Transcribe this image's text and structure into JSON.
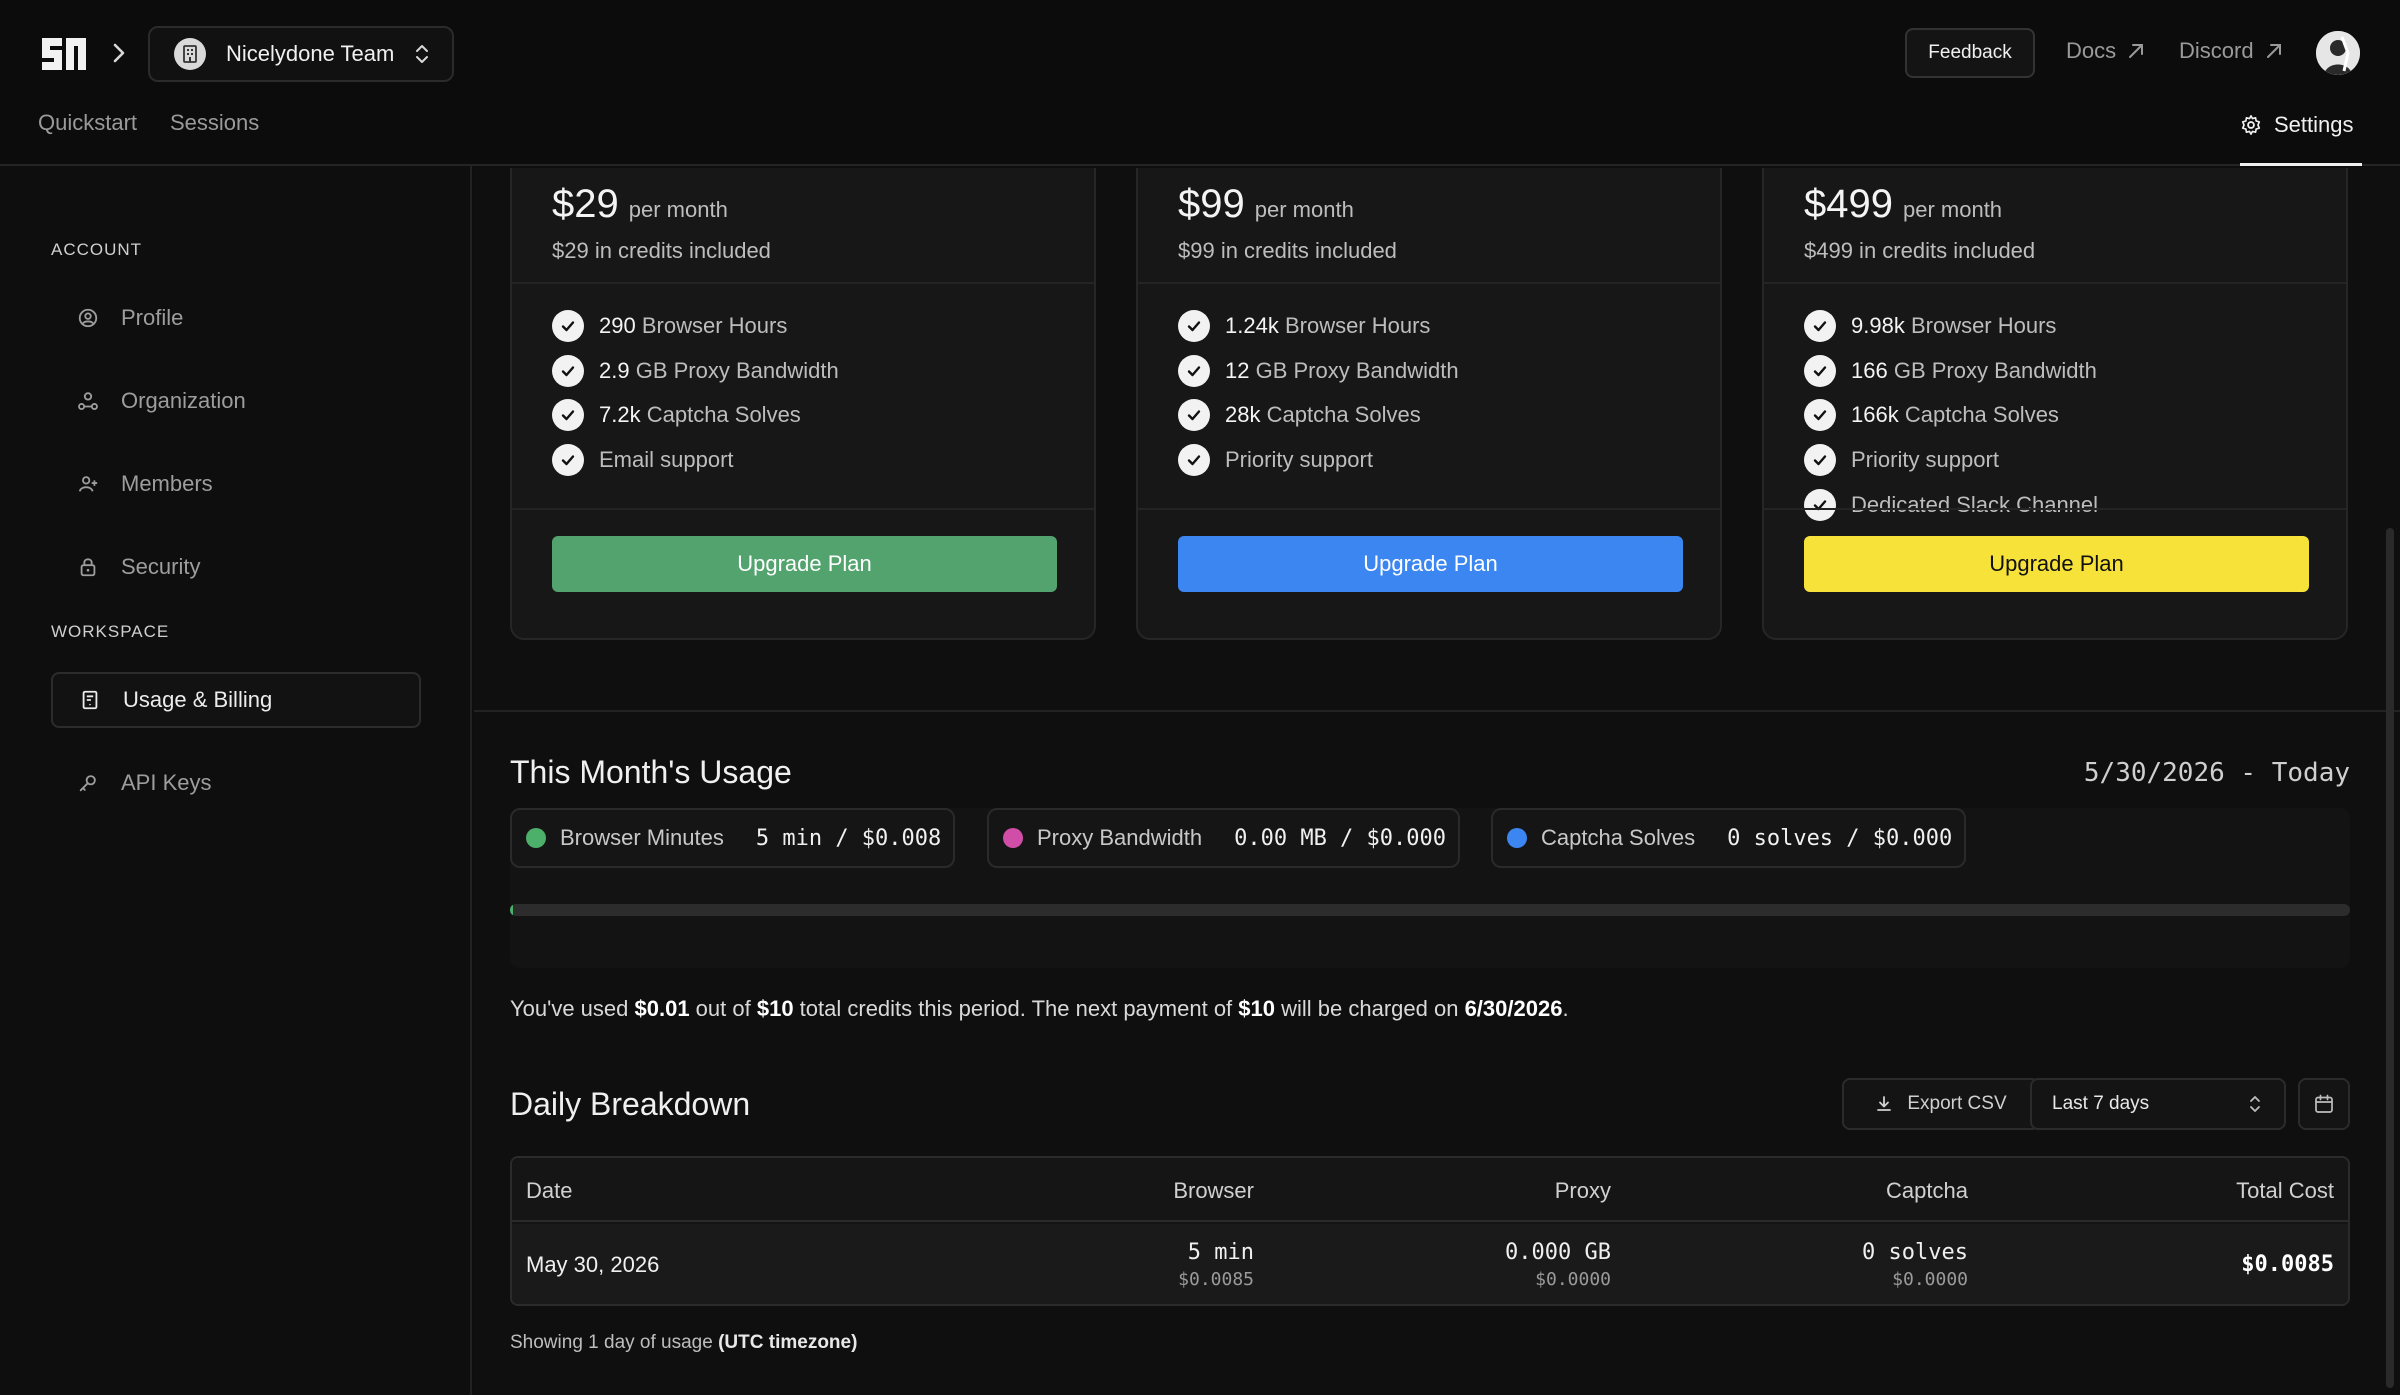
{
  "header": {
    "team_name": "Nicelydone Team",
    "feedback_label": "Feedback",
    "docs_label": "Docs",
    "discord_label": "Discord",
    "nav": [
      "Quickstart",
      "Sessions"
    ],
    "settings_label": "Settings"
  },
  "sidebar": {
    "account_label": "ACCOUNT",
    "workspace_label": "WORKSPACE",
    "items": [
      {
        "label": "Profile",
        "icon": "user-circle-icon"
      },
      {
        "label": "Organization",
        "icon": "organization-icon"
      },
      {
        "label": "Members",
        "icon": "add-user-icon"
      },
      {
        "label": "Security",
        "icon": "lock-icon"
      },
      {
        "label": "Usage & Billing",
        "icon": "receipt-icon",
        "active": true
      },
      {
        "label": "API Keys",
        "icon": "key-icon"
      }
    ]
  },
  "plans": [
    {
      "price": "$29",
      "per": "per month",
      "credits": "$29 in credits included",
      "features": [
        {
          "num": "290",
          "text": "Browser Hours"
        },
        {
          "num": "2.9",
          "text": "GB Proxy Bandwidth"
        },
        {
          "num": "7.2k",
          "text": "Captcha Solves"
        },
        {
          "num": "",
          "text": "Email support"
        }
      ],
      "button": "Upgrade Plan",
      "button_color": "#52a36e",
      "button_text_color": "#ffffff"
    },
    {
      "price": "$99",
      "per": "per month",
      "credits": "$99 in credits included",
      "features": [
        {
          "num": "1.24k",
          "text": "Browser Hours"
        },
        {
          "num": "12",
          "text": "GB Proxy Bandwidth"
        },
        {
          "num": "28k",
          "text": "Captcha Solves"
        },
        {
          "num": "",
          "text": "Priority support"
        }
      ],
      "button": "Upgrade Plan",
      "button_color": "#3b86f0",
      "button_text_color": "#ffffff"
    },
    {
      "price": "$499",
      "per": "per month",
      "credits": "$499 in credits included",
      "features": [
        {
          "num": "9.98k",
          "text": "Browser Hours"
        },
        {
          "num": "166",
          "text": "GB Proxy Bandwidth"
        },
        {
          "num": "166k",
          "text": "Captcha Solves"
        },
        {
          "num": "",
          "text": "Priority support"
        },
        {
          "num": "",
          "text": "Dedicated Slack Channel"
        }
      ],
      "button": "Upgrade Plan",
      "button_color": "#f7e23a",
      "button_text_color": "#111111"
    }
  ],
  "usage": {
    "title": "This Month's Usage",
    "range": "5/30/2026 - Today",
    "pills": [
      {
        "label": "Browser Minutes",
        "value": "5 min / $0.008",
        "color": "#4caf6a"
      },
      {
        "label": "Proxy Bandwidth",
        "value": "0.00 MB / $0.000",
        "color": "#d04ea8"
      },
      {
        "label": "Captcha Solves",
        "value": "0 solves / $0.000",
        "color": "#3b86f0"
      }
    ],
    "fill_fraction": 0.001,
    "note": {
      "p1": "You've used ",
      "used": "$0.01",
      "p2": " out of ",
      "total": "$10",
      "p3": " total credits this period. The next payment of ",
      "payment": "$10",
      "p4": " will be charged on ",
      "date": "6/30/2026",
      "p5": "."
    }
  },
  "daily": {
    "title": "Daily Breakdown",
    "export_label": "Export CSV",
    "range_value": "Last 7 days",
    "columns": [
      "Date",
      "Browser",
      "Proxy",
      "Captcha",
      "Total Cost"
    ],
    "rows": [
      {
        "date": "May 30, 2026",
        "browser": "5 min",
        "browser_cost": "$0.0085",
        "proxy": "0.000 GB",
        "proxy_cost": "$0.0000",
        "captcha": "0 solves",
        "captcha_cost": "$0.0000",
        "total": "$0.0085"
      }
    ],
    "footer_text": "Showing 1 day of usage ",
    "footer_bold": "(UTC timezone)"
  }
}
